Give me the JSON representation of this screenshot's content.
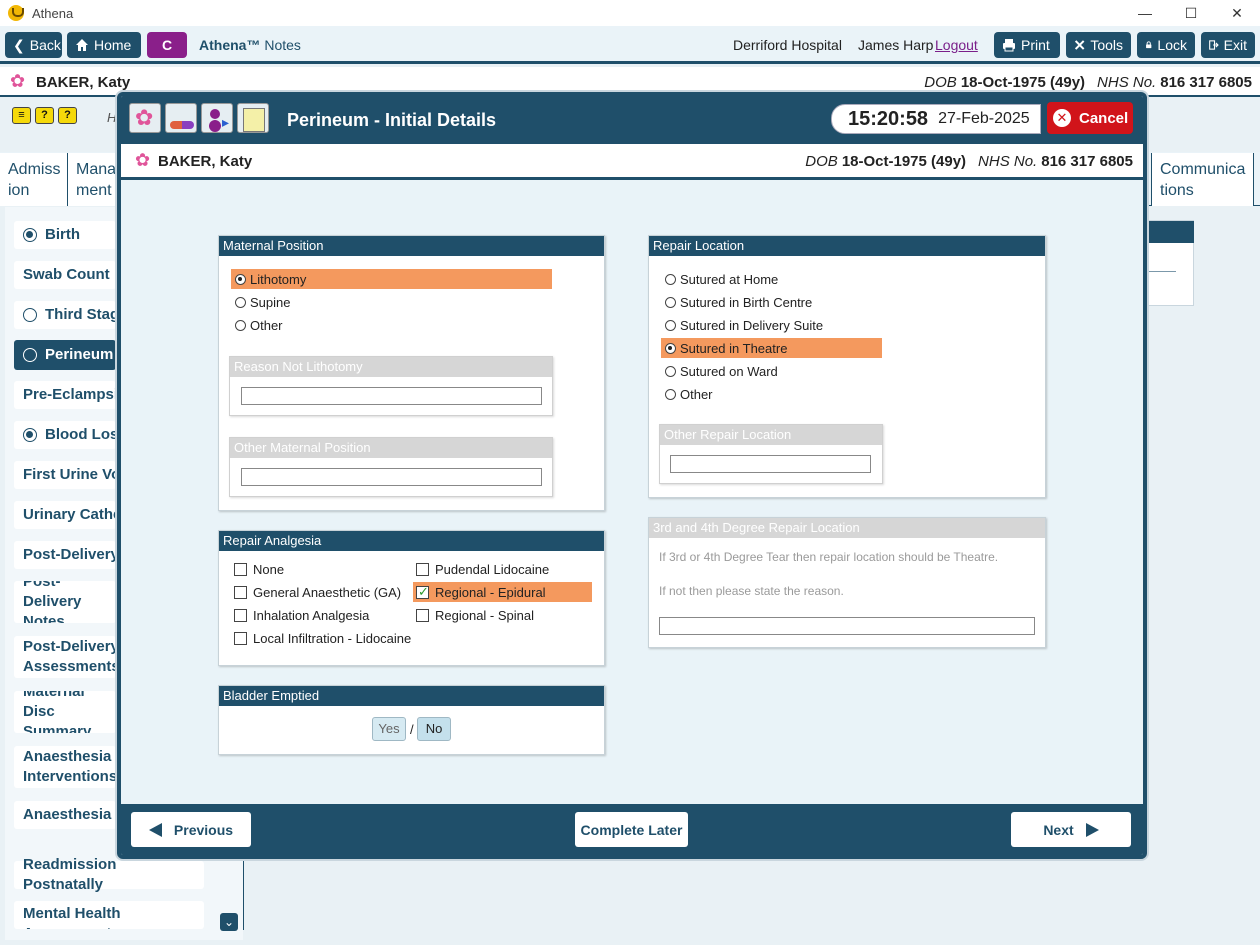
{
  "window": {
    "title": "Athena",
    "minimize": "—",
    "maximize": "☐",
    "close": "✕"
  },
  "topnav": {
    "back": "Back",
    "home": "Home",
    "c_button": "C",
    "brand_name": "Athena™",
    "brand_suffix": "Notes",
    "hospital": "Derriford Hospital",
    "user": "James Harp",
    "logout": "Logout",
    "print": "Print",
    "tools": "Tools",
    "lock": "Lock",
    "exit": "Exit"
  },
  "patient": {
    "name": "BAKER, Katy",
    "dob_label": "DOB",
    "dob": "18-Oct-1975 (49y)",
    "nhs_label": "NHS No.",
    "nhs": "816 317 6805"
  },
  "background": {
    "h_letter": "H",
    "tabs": [
      "Admiss ion",
      "Mana ment",
      "Communica tions"
    ],
    "sidebar": [
      {
        "label": "Birth",
        "radio": "on"
      },
      {
        "label": "Swab Count",
        "radio": "none"
      },
      {
        "label": "Third Stage",
        "radio": "off"
      },
      {
        "label": "Perineum",
        "radio": "off",
        "active": true
      },
      {
        "label": "Pre-Eclampsia",
        "radio": "none"
      },
      {
        "label": "Blood Loss",
        "radio": "on"
      },
      {
        "label": "First Urine Voi",
        "radio": "none"
      },
      {
        "label": "Urinary Cathe",
        "radio": "none"
      },
      {
        "label": "Post-Delivery",
        "radio": "none"
      },
      {
        "label": "Post-Delivery Notes",
        "radio": "none"
      },
      {
        "label": "Post-Delivery Assessments",
        "radio": "none"
      },
      {
        "label": "Maternal Disc Summary",
        "radio": "none"
      },
      {
        "label": "Anaesthesia Interventions",
        "radio": "none"
      },
      {
        "label": "Anaesthesia F",
        "radio": "none"
      },
      {
        "label": "Readmission Postnatally",
        "radio": "none"
      },
      {
        "label": "Mental Health Assessment",
        "radio": "none"
      }
    ]
  },
  "modal": {
    "title": "Perineum - Initial Details",
    "time": "15:20:58",
    "date": "27-Feb-2025",
    "cancel": "Cancel",
    "maternal_position": {
      "header": "Maternal Position",
      "options": [
        "Lithotomy",
        "Supine",
        "Other"
      ],
      "selected": "Lithotomy",
      "reason_not_lithotomy": {
        "label": "Reason Not Lithotomy",
        "value": ""
      },
      "other_maternal_position": {
        "label": "Other Maternal Position",
        "value": ""
      }
    },
    "repair_location": {
      "header": "Repair Location",
      "options": [
        "Sutured at Home",
        "Sutured in Birth Centre",
        "Sutured in Delivery Suite",
        "Sutured in Theatre",
        "Sutured on Ward",
        "Other"
      ],
      "selected": "Sutured in Theatre",
      "other_repair_location": {
        "label": "Other Repair Location",
        "value": ""
      }
    },
    "degree_repair": {
      "header": "3rd and 4th Degree Repair Location",
      "hint1": "If 3rd or 4th Degree Tear then repair location should be Theatre.",
      "hint2": "If not then please state the reason.",
      "value": ""
    },
    "repair_analgesia": {
      "header": "Repair Analgesia",
      "left": [
        "None",
        "General Anaesthetic (GA)",
        "Inhalation Analgesia",
        "Local Infiltration - Lidocaine"
      ],
      "right": [
        "Pudendal Lidocaine",
        "Regional - Epidural",
        "Regional - Spinal"
      ],
      "checked": [
        "Regional - Epidural"
      ]
    },
    "bladder_emptied": {
      "header": "Bladder Emptied",
      "yes": "Yes",
      "separator": "/",
      "no": "No"
    },
    "footer": {
      "previous": "Previous",
      "complete_later": "Complete Later",
      "next": "Next"
    }
  }
}
